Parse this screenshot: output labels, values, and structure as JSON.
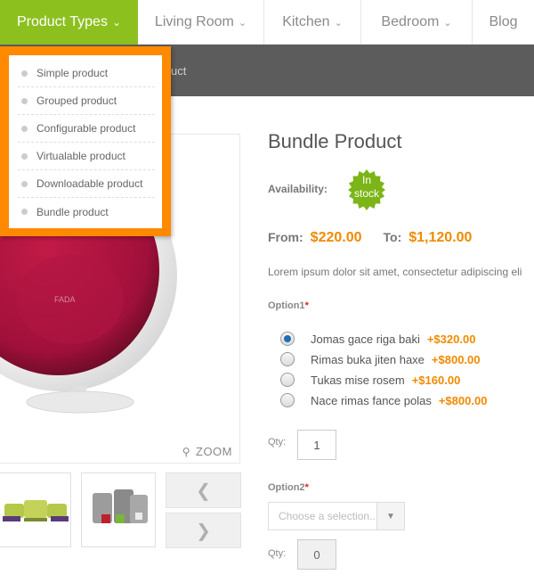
{
  "nav": {
    "items": [
      {
        "label": "Product Types",
        "has_caret": true,
        "active": true
      },
      {
        "label": "Living Room",
        "has_caret": true
      },
      {
        "label": "Kitchen",
        "has_caret": true
      },
      {
        "label": "Bedroom",
        "has_caret": true
      },
      {
        "label": "Blog",
        "has_caret": false
      }
    ]
  },
  "breadcrumb": {
    "text": "uct"
  },
  "dropdown": {
    "items": [
      "Simple product",
      "Grouped product",
      "Configurable product",
      "Virtualable product",
      "Downloadable product",
      "Bundle product"
    ]
  },
  "gallery": {
    "zoom_label": "ZOOM"
  },
  "product": {
    "title": "Bundle Product",
    "availability_label": "Availability:",
    "stock_label_line1": "In",
    "stock_label_line2": "stock",
    "price_from_label": "From:",
    "price_from": "$220.00",
    "price_to_label": "To:",
    "price_to": "$1,120.00",
    "description": "Lorem ipsum dolor sit amet, consectetur adipiscing eli"
  },
  "option1": {
    "label": "Option1",
    "required_mark": "*",
    "choices": [
      {
        "name": "Jomas gace riga baki",
        "price": "+$320.00",
        "selected": true
      },
      {
        "name": "Rimas buka jiten haxe",
        "price": "+$800.00",
        "selected": false
      },
      {
        "name": "Tukas mise rosem",
        "price": "+$160.00",
        "selected": false
      },
      {
        "name": "Nace rimas fance polas",
        "price": "+$800.00",
        "selected": false
      }
    ],
    "qty_label": "Qty:",
    "qty_value": "1"
  },
  "option2": {
    "label": "Option2",
    "required_mark": "*",
    "select_placeholder": "Choose a selection...",
    "qty_label": "Qty:",
    "qty_value": "0"
  },
  "colors": {
    "accent_green": "#8cc01f",
    "dropdown_orange": "#ff8a00",
    "price_orange": "#f08a00",
    "required_red": "#e0241b"
  }
}
